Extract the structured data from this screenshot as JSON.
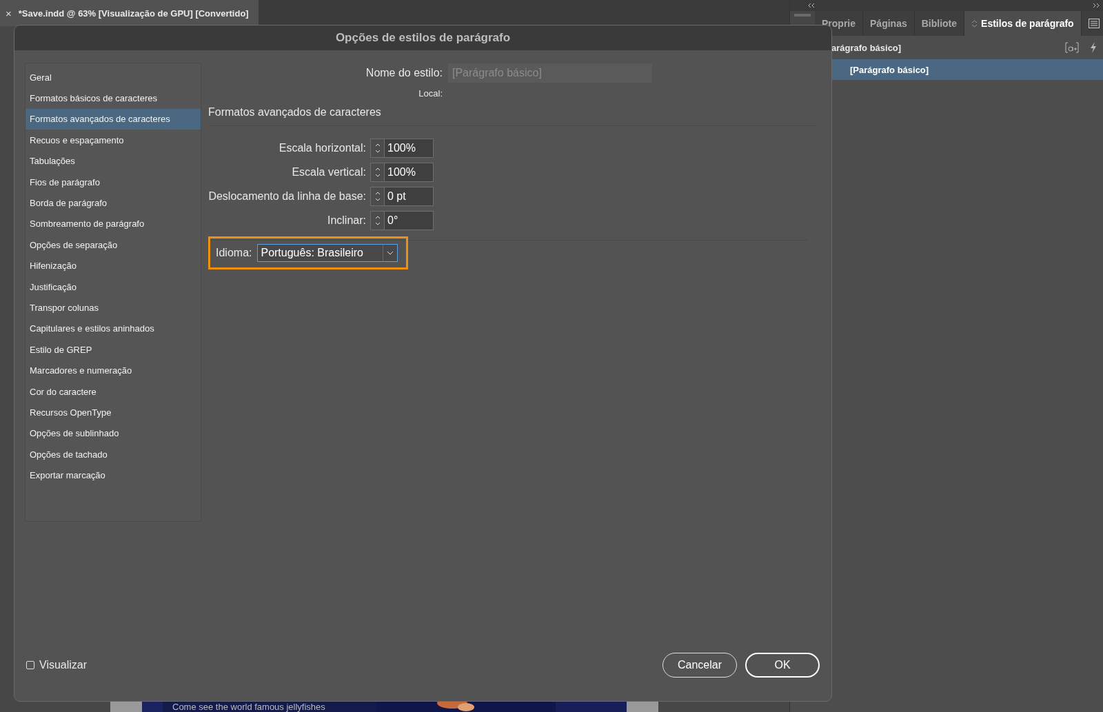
{
  "document_tab": {
    "close": "×",
    "title": "*Save.indd @ 63% [Visualização de GPU] [Convertido]"
  },
  "document_page": {
    "caption": "Come see the world famous jellyfishes"
  },
  "panel": {
    "tabs": [
      {
        "label": "Proprie",
        "selected": false
      },
      {
        "label": "Páginas",
        "selected": false
      },
      {
        "label": "Bibliote",
        "selected": false
      },
      {
        "label": "Estilos de parágrafo",
        "selected": true
      }
    ],
    "current_style": "arágrafo básico]",
    "styles": [
      {
        "label": "[Parágrafo básico]",
        "selected": true
      }
    ]
  },
  "dialog": {
    "title": "Opções de estilos de parágrafo",
    "categories": [
      {
        "label": "Geral",
        "selected": false
      },
      {
        "label": "Formatos básicos de caracteres",
        "selected": false
      },
      {
        "label": "Formatos avançados de caracteres",
        "selected": true
      },
      {
        "label": "Recuos e espaçamento",
        "selected": false
      },
      {
        "label": "Tabulações",
        "selected": false
      },
      {
        "label": "Fios de parágrafo",
        "selected": false
      },
      {
        "label": "Borda de parágrafo",
        "selected": false
      },
      {
        "label": "Sombreamento de parágrafo",
        "selected": false
      },
      {
        "label": "Opções de separação",
        "selected": false
      },
      {
        "label": "Hifenização",
        "selected": false
      },
      {
        "label": "Justificação",
        "selected": false
      },
      {
        "label": "Transpor colunas",
        "selected": false
      },
      {
        "label": "Capitulares e estilos aninhados",
        "selected": false
      },
      {
        "label": "Estilo de GREP",
        "selected": false
      },
      {
        "label": "Marcadores e numeração",
        "selected": false
      },
      {
        "label": "Cor do caractere",
        "selected": false
      },
      {
        "label": "Recursos OpenType",
        "selected": false
      },
      {
        "label": "Opções de sublinhado",
        "selected": false
      },
      {
        "label": "Opções de tachado",
        "selected": false
      },
      {
        "label": "Exportar marcação",
        "selected": false
      }
    ],
    "style_name_label": "Nome do estilo:",
    "style_name_placeholder": "[Parágrafo básico]",
    "location_label": "Local:",
    "section_title": "Formatos avançados de caracteres",
    "fields": [
      {
        "label": "Escala horizontal:",
        "value": "100%"
      },
      {
        "label": "Escala vertical:",
        "value": "100%"
      },
      {
        "label": "Deslocamento da linha de base:",
        "value": "0 pt"
      },
      {
        "label": "Inclinar:",
        "value": "0°"
      }
    ],
    "language": {
      "label": "Idioma:",
      "value": "Português: Brasileiro",
      "highlighted": true
    },
    "preview": {
      "label": "Visualizar",
      "checked": false
    },
    "buttons": [
      {
        "label": "Cancelar",
        "default": false
      },
      {
        "label": "OK",
        "default": true
      }
    ]
  }
}
